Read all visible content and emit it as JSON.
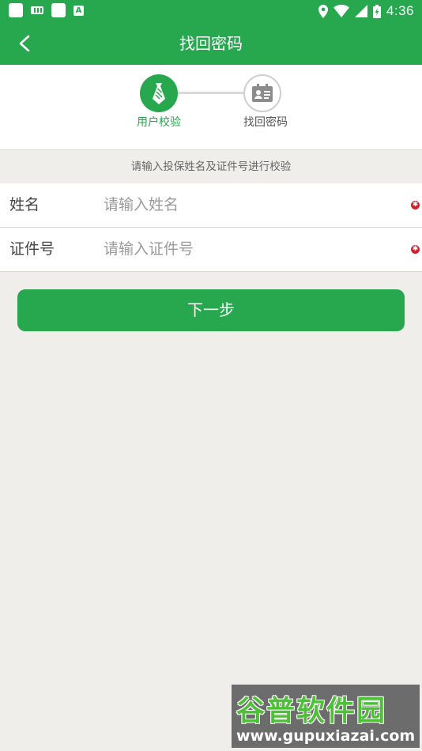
{
  "status_bar": {
    "time": "4:36",
    "icons": [
      "notification-square-icon",
      "keyboard-icon",
      "notification-square-icon",
      "a-badge-icon",
      "location-icon",
      "wifi-icon",
      "signal-icon",
      "battery-icon"
    ],
    "a_badge": "A"
  },
  "app_bar": {
    "title": "找回密码",
    "back_icon": "chevron-left-icon"
  },
  "steps": {
    "items": [
      {
        "label": "用户校验",
        "icon": "tie-icon",
        "active": true
      },
      {
        "label": "找回密码",
        "icon": "id-card-icon",
        "active": false
      }
    ]
  },
  "form": {
    "hint": "请输入投保姓名及证件号进行校验",
    "fields": [
      {
        "label": "姓名",
        "placeholder": "请输入姓名",
        "value": "",
        "required": true
      },
      {
        "label": "证件号",
        "placeholder": "请输入证件号",
        "value": "",
        "required": true
      }
    ]
  },
  "actions": {
    "next_label": "下一步"
  },
  "watermark": {
    "title": "谷普软件园",
    "url": "www.gupuxiazai.com"
  },
  "colors": {
    "brand": "#27a84f",
    "background": "#efeeeb",
    "required": "#d0202a"
  }
}
